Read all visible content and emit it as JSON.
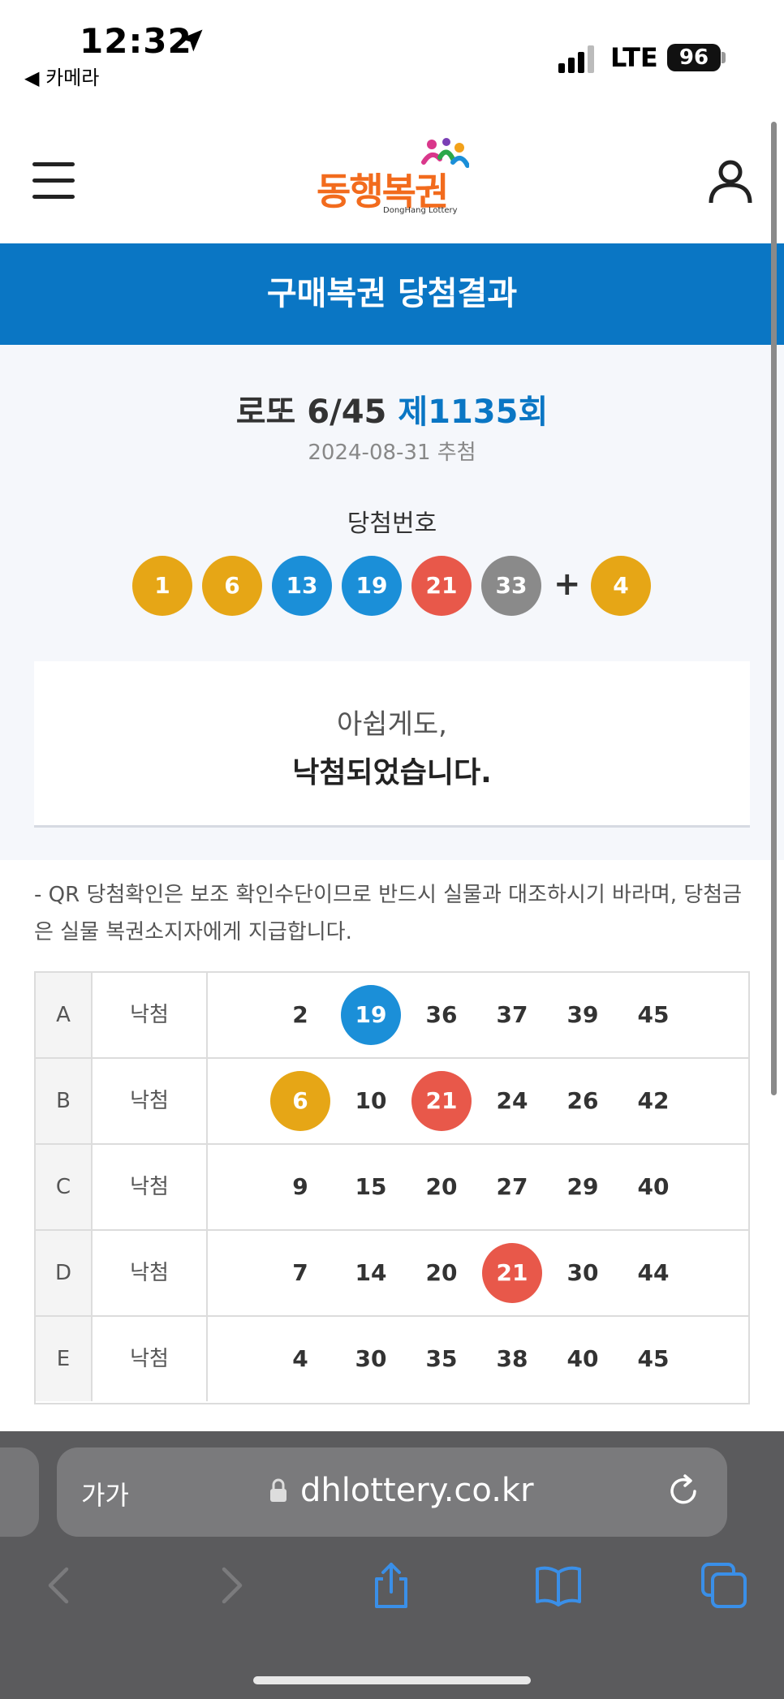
{
  "status_bar": {
    "time": "12:32",
    "back_label": "◀ 카메라",
    "network": "LTE",
    "battery": "96"
  },
  "header": {
    "logo_text": "동행복권",
    "logo_sub": "DongHang Lottery"
  },
  "page_title": "구매복권 당첨결과",
  "draw": {
    "game": "로또 6/45",
    "round": "제1135회",
    "date": "2024-08-31 추첨",
    "winning_label": "당첨번호",
    "numbers": [
      "1",
      "6",
      "13",
      "19",
      "21",
      "33"
    ],
    "plus": "+",
    "bonus": "4"
  },
  "result": {
    "line1": "아쉽게도,",
    "line2": "낙첨되었습니다."
  },
  "notice": "- QR 당첨확인은 보조 확인수단이므로 반드시 실물과 대조하시기 바라며, 당첨금은 실물 복권소지자에게 지급합니다.",
  "ticket": [
    {
      "id": "A",
      "result": "낙첨",
      "numbers": [
        "2",
        "19",
        "36",
        "37",
        "39",
        "45"
      ]
    },
    {
      "id": "B",
      "result": "낙첨",
      "numbers": [
        "6",
        "10",
        "21",
        "24",
        "26",
        "42"
      ]
    },
    {
      "id": "C",
      "result": "낙첨",
      "numbers": [
        "9",
        "15",
        "20",
        "27",
        "29",
        "40"
      ]
    },
    {
      "id": "D",
      "result": "낙첨",
      "numbers": [
        "7",
        "14",
        "20",
        "21",
        "30",
        "44"
      ]
    },
    {
      "id": "E",
      "result": "낙첨",
      "numbers": [
        "4",
        "30",
        "35",
        "38",
        "40",
        "45"
      ]
    }
  ],
  "browser": {
    "text_size_label": "가가",
    "url": "dhlottery.co.kr"
  },
  "colors": {
    "brand_blue": "#0a76c4",
    "ball_yellow": "#e6a616",
    "ball_blue": "#1b8fd8",
    "ball_red": "#e8584a",
    "ball_gray": "#8a8a8a"
  }
}
